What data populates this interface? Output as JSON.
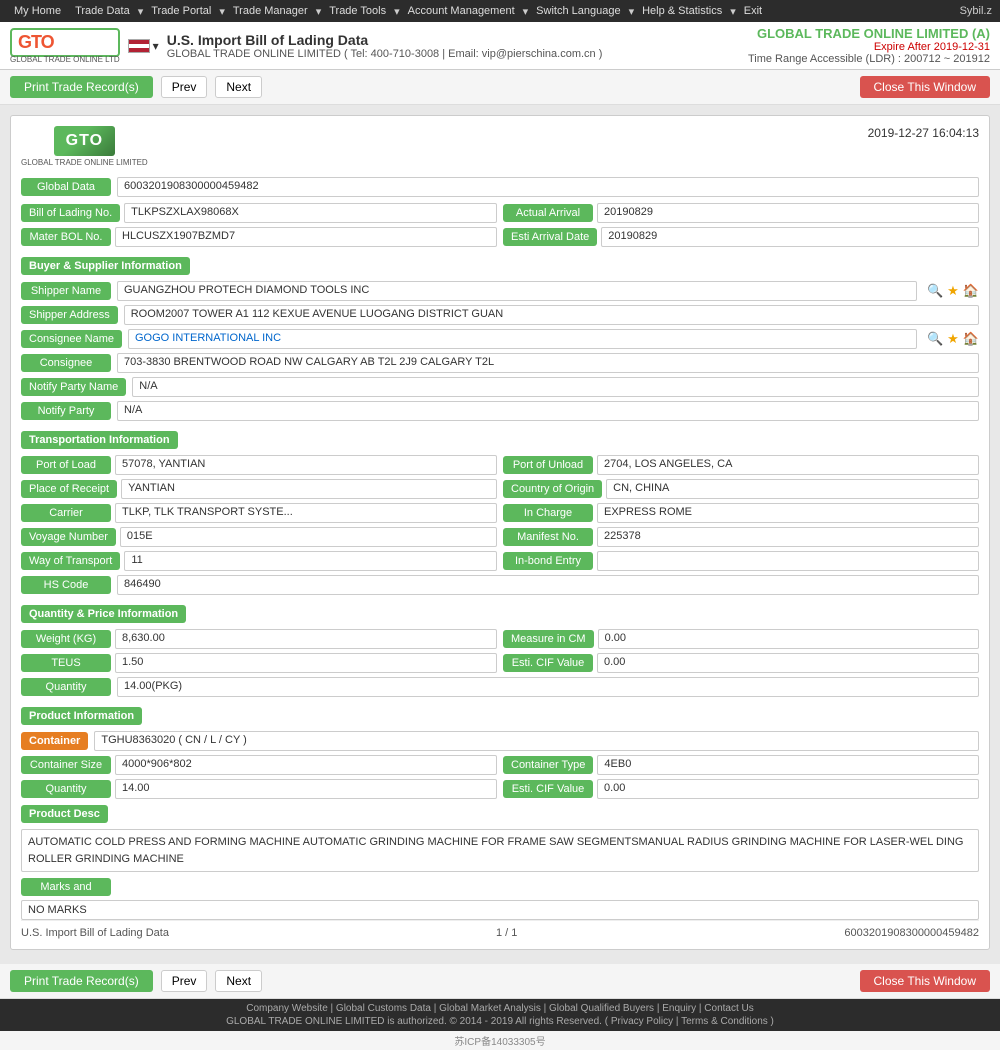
{
  "nav": {
    "items": [
      "My Home",
      "Trade Data",
      "Trade Portal",
      "Trade Manager",
      "Trade Tools",
      "Account Management",
      "Switch Language",
      "Help & Statistics",
      "Exit"
    ],
    "user": "Sybil.z"
  },
  "header": {
    "logo_text": "GTO",
    "logo_sub": "GLOBAL TRADE ONLINE LTD",
    "flag_alt": "US Flag",
    "title": "U.S. Import Bill of Lading Data",
    "company_name": "GLOBAL TRADE ONLINE LIMITED",
    "tel": "Tel: 400-710-3008",
    "email": "Email: vip@pierschina.com.cn",
    "company_display": "GLOBAL TRADE ONLINE LIMITED (A)",
    "expire": "Expire After 2019-12-31",
    "time_range": "Time Range Accessible (LDR) : 200712 ~ 201912"
  },
  "toolbar": {
    "print_label": "Print Trade Record(s)",
    "prev_label": "Prev",
    "next_label": "Next",
    "close_label": "Close This Window"
  },
  "record": {
    "datetime": "2019-12-27 16:04:13",
    "global_data_label": "Global Data",
    "global_data_value": "6003201908300000459482",
    "bol_no_label": "Bill of Lading No.",
    "bol_no_value": "TLKPSZXLAX98068X",
    "actual_arrival_label": "Actual Arrival",
    "actual_arrival_value": "20190829",
    "mater_bol_label": "Mater BOL No.",
    "mater_bol_value": "HLCUSZX1907BZMD7",
    "esti_arrival_label": "Esti Arrival Date",
    "esti_arrival_value": "20190829"
  },
  "buyer_supplier": {
    "section_title": "Buyer & Supplier Information",
    "shipper_name_label": "Shipper Name",
    "shipper_name_value": "GUANGZHOU PROTECH DIAMOND TOOLS INC",
    "shipper_address_label": "Shipper Address",
    "shipper_address_value": "ROOM2007 TOWER A1 112 KEXUE AVENUE LUOGANG DISTRICT GUAN",
    "consignee_name_label": "Consignee Name",
    "consignee_name_value": "GOGO INTERNATIONAL INC",
    "consignee_label": "Consignee",
    "consignee_value": "703-3830 BRENTWOOD ROAD NW CALGARY AB T2L 2J9 CALGARY T2L",
    "notify_party_name_label": "Notify Party Name",
    "notify_party_name_value": "N/A",
    "notify_party_label": "Notify Party",
    "notify_party_value": "N/A"
  },
  "transportation": {
    "section_title": "Transportation Information",
    "port_of_load_label": "Port of Load",
    "port_of_load_value": "57078, YANTIAN",
    "port_of_unload_label": "Port of Unload",
    "port_of_unload_value": "2704, LOS ANGELES, CA",
    "place_of_receipt_label": "Place of Receipt",
    "place_of_receipt_value": "YANTIAN",
    "country_of_origin_label": "Country of Origin",
    "country_of_origin_value": "CN, CHINA",
    "carrier_label": "Carrier",
    "carrier_value": "TLKP, TLK TRANSPORT SYSTE...",
    "in_charge_label": "In Charge",
    "in_charge_value": "EXPRESS ROME",
    "voyage_number_label": "Voyage Number",
    "voyage_number_value": "015E",
    "manifest_no_label": "Manifest No.",
    "manifest_no_value": "225378",
    "way_of_transport_label": "Way of Transport",
    "way_of_transport_value": "11",
    "in_bond_entry_label": "In-bond Entry",
    "in_bond_entry_value": "",
    "hs_code_label": "HS Code",
    "hs_code_value": "846490"
  },
  "quantity_price": {
    "section_title": "Quantity & Price Information",
    "weight_label": "Weight (KG)",
    "weight_value": "8,630.00",
    "measure_label": "Measure in CM",
    "measure_value": "0.00",
    "teus_label": "TEUS",
    "teus_value": "1.50",
    "esti_cif_label": "Esti. CIF Value",
    "esti_cif_value": "0.00",
    "quantity_label": "Quantity",
    "quantity_value": "14.00(PKG)"
  },
  "product": {
    "section_title": "Product Information",
    "container_label": "Container",
    "container_value": "TGHU8363020 ( CN / L / CY )",
    "container_size_label": "Container Size",
    "container_size_value": "4000*906*802",
    "container_type_label": "Container Type",
    "container_type_value": "4EB0",
    "quantity_label": "Quantity",
    "quantity_value": "14.00",
    "esti_cif_label": "Esti. CIF Value",
    "esti_cif_value": "0.00",
    "product_desc_label": "Product Desc",
    "product_desc_text": "AUTOMATIC COLD PRESS AND FORMING MACHINE AUTOMATIC GRINDING MACHINE FOR FRAME SAW SEGMENTSMANUAL RADIUS GRINDING MACHINE FOR LASER-WEL DING ROLLER GRINDING MACHINE",
    "marks_label": "Marks and",
    "marks_value": "NO MARKS"
  },
  "card_footer": {
    "left": "U.S. Import Bill of Lading Data",
    "page": "1 / 1",
    "right": "6003201908300000459482"
  },
  "bottom_toolbar": {
    "print_label": "Print Trade Record(s)",
    "prev_label": "Prev",
    "next_label": "Next",
    "close_label": "Close This Window"
  },
  "footer": {
    "links": [
      "Company Website",
      "Global Customs Data",
      "Global Market Analysis",
      "Global Qualified Buyers",
      "Enquiry",
      "Contact Us"
    ],
    "copyright": "GLOBAL TRADE ONLINE LIMITED is authorized. © 2014 - 2019 All rights Reserved.",
    "privacy_policy": "Privacy Policy",
    "terms": "Terms & Conditions",
    "icp": "苏ICP备14033305号"
  }
}
